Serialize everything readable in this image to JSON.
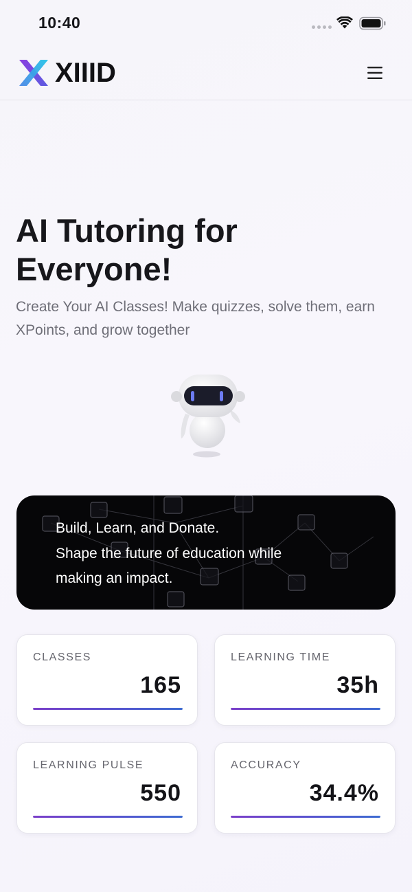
{
  "status_bar": {
    "time": "10:40"
  },
  "header": {
    "brand": "XIIID",
    "logo_icon": "xiiid-logo-icon",
    "menu_icon": "hamburger-menu-icon"
  },
  "hero": {
    "title": "AI Tutoring for Everyone!",
    "subtitle": "Create Your AI Classes! Make quizzes, solve them, earn XPoints, and grow together",
    "illustration_icon": "robot-icon"
  },
  "banner": {
    "lines": [
      "Build, Learn, and Donate.",
      "Shape the future of education while",
      "making an impact."
    ]
  },
  "stats": [
    {
      "label": "CLASSES",
      "value": "165",
      "progress": 1.0
    },
    {
      "label": "LEARNING TIME",
      "value": "35h",
      "progress": 1.0
    },
    {
      "label": "LEARNING PULSE",
      "value": "550",
      "progress": 1.0
    },
    {
      "label": "ACCURACY",
      "value": "34.4%",
      "progress": 1.0
    }
  ],
  "colors": {
    "accent_gradient_start": "#7b3fc9",
    "accent_gradient_end": "#3d6bd1",
    "logo_cyan": "#27c4e8",
    "logo_purple": "#8a3ee0",
    "banner_bg": "#060608"
  }
}
